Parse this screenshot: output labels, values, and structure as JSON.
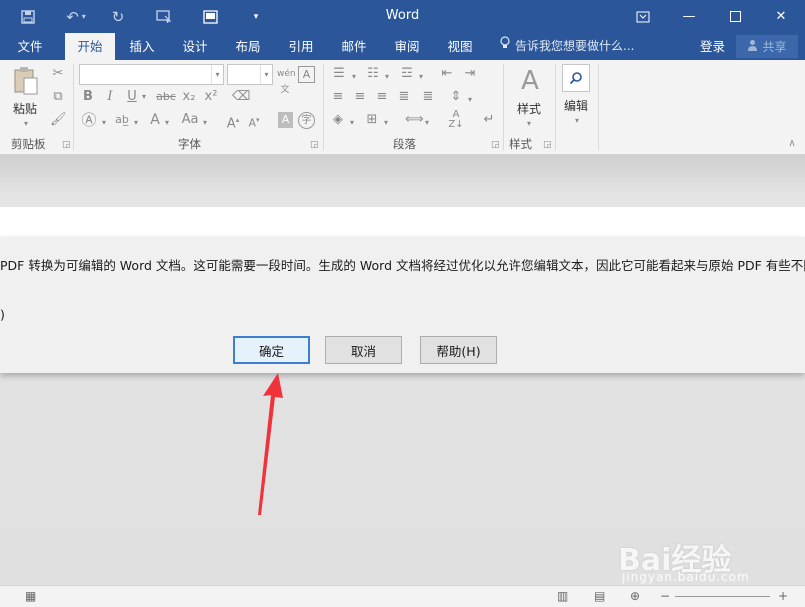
{
  "window": {
    "title": "Word",
    "controls": [
      "ribbon-display-icon",
      "minimize-icon",
      "maximize-icon",
      "close-icon"
    ]
  },
  "quick_access": [
    "save-icon",
    "undo-icon",
    "redo-icon",
    "touch-mode-icon",
    "layout-icon",
    "customize-icon"
  ],
  "tabs": [
    {
      "label": "文件"
    },
    {
      "label": "开始"
    },
    {
      "label": "插入"
    },
    {
      "label": "设计"
    },
    {
      "label": "布局"
    },
    {
      "label": "引用"
    },
    {
      "label": "邮件"
    },
    {
      "label": "审阅"
    },
    {
      "label": "视图"
    }
  ],
  "tell_me": "告诉我您想要做什么...",
  "account": {
    "login": "登录",
    "share": "共享"
  },
  "ribbon": {
    "clipboard": {
      "paste": "粘贴",
      "label": "剪贴板"
    },
    "font": {
      "label": "字体",
      "bold": "B",
      "italic": "I",
      "underline": "U",
      "strike": "abc",
      "sub": "x₂",
      "sup": "x²",
      "case": "Aa"
    },
    "paragraph": {
      "label": "段落"
    },
    "styles": {
      "button": "样式",
      "label": "样式"
    },
    "editing": {
      "button": "编辑"
    }
  },
  "dialog": {
    "message": "PDF 转换为可编辑的 Word 文档。这可能需要一段时间。生成的 Word 文档将经过优化以允许您编辑文本，因此它可能看起来与原始 PDF 有些不同，尤",
    "message2": ")",
    "ok": "确定",
    "cancel": "取消",
    "help": "帮助(H)"
  },
  "watermark": {
    "brand": "Bai经验",
    "url": "jingyan.baidu.com"
  },
  "colors": {
    "accent": "#2b579a",
    "arrow": "#f0333b"
  }
}
